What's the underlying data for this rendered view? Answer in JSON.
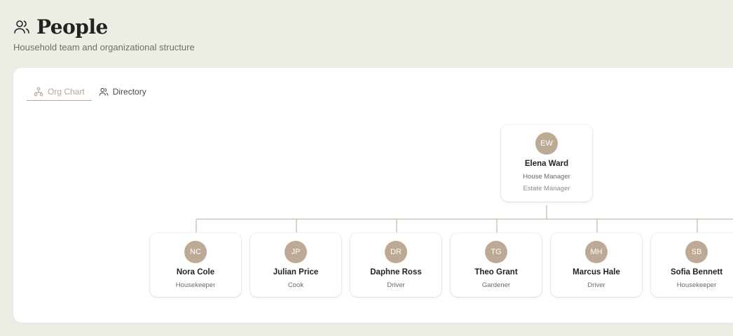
{
  "header": {
    "title": "People",
    "subtitle": "Household team and organizational structure"
  },
  "tabs": [
    {
      "label": "Org Chart",
      "icon": "org-chart-icon",
      "active": true
    },
    {
      "label": "Directory",
      "icon": "users-icon",
      "active": false
    }
  ],
  "org": {
    "root": {
      "initials": "EW",
      "name": "Elena Ward",
      "role": "House Manager",
      "department": "Estate Manager"
    },
    "reports": [
      {
        "initials": "NC",
        "name": "Nora Cole",
        "role": "Housekeeper"
      },
      {
        "initials": "JP",
        "name": "Julian Price",
        "role": "Cook"
      },
      {
        "initials": "DR",
        "name": "Daphne Ross",
        "role": "Driver"
      },
      {
        "initials": "TG",
        "name": "Theo Grant",
        "role": "Gardener"
      },
      {
        "initials": "MH",
        "name": "Marcus Hale",
        "role": "Driver"
      },
      {
        "initials": "SB",
        "name": "Sofia Bennett",
        "role": "Housekeeper"
      }
    ]
  },
  "colors": {
    "accent": "#b6a48e",
    "avatar": "#bcaa94",
    "connector": "#b8a993"
  }
}
